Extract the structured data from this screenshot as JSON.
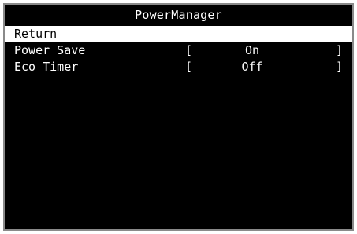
{
  "menu": {
    "title": "PowerManager",
    "items": [
      {
        "label": "Return",
        "selected": true
      },
      {
        "label": "Power Save",
        "bracket_open": "[",
        "value": "On",
        "bracket_close": "]"
      },
      {
        "label": "Eco Timer",
        "bracket_open": "[",
        "value": "Off",
        "bracket_close": "]"
      }
    ]
  },
  "colors": {
    "background": "#000000",
    "text": "#ffffff",
    "selected_background": "#ffffff",
    "selected_text": "#000000",
    "border": "#8a8a8a"
  }
}
